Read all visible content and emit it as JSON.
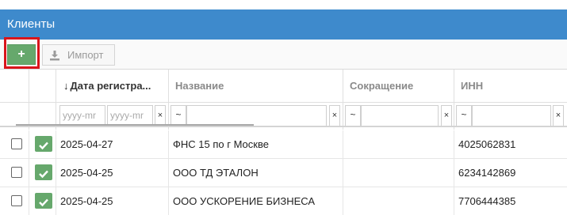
{
  "window": {
    "title": "Клиенты"
  },
  "toolbar": {
    "add_label": "+",
    "import_label": "Импорт"
  },
  "table": {
    "columns": {
      "date": "Дата регистра...",
      "name": "Название",
      "short": "Сокращение",
      "inn": "ИНН"
    },
    "filters": {
      "date_from_placeholder": "yyyy-mr",
      "date_to_placeholder": "yyyy-mr",
      "operator": "~",
      "clear": "×"
    },
    "rows": [
      {
        "date": "2025-04-27",
        "name": "ФНС 15 по г Москве",
        "short": "",
        "inn": "4025062831",
        "active": true
      },
      {
        "date": "2025-04-25",
        "name": "ООО ТД ЭТАЛОН",
        "short": "",
        "inn": "6234142869",
        "active": true
      },
      {
        "date": "2025-04-25",
        "name": "ООО УСКОРЕНИЕ БИЗНЕСА",
        "short": "",
        "inn": "7706444385",
        "active": true
      }
    ]
  },
  "colors": {
    "accent": "#3e8acc",
    "success": "#66a86c",
    "highlight": "#d9151b"
  },
  "icons": {
    "add": "plus-icon",
    "import": "download-icon",
    "sort": "arrow-down-icon",
    "status": "check-icon"
  }
}
